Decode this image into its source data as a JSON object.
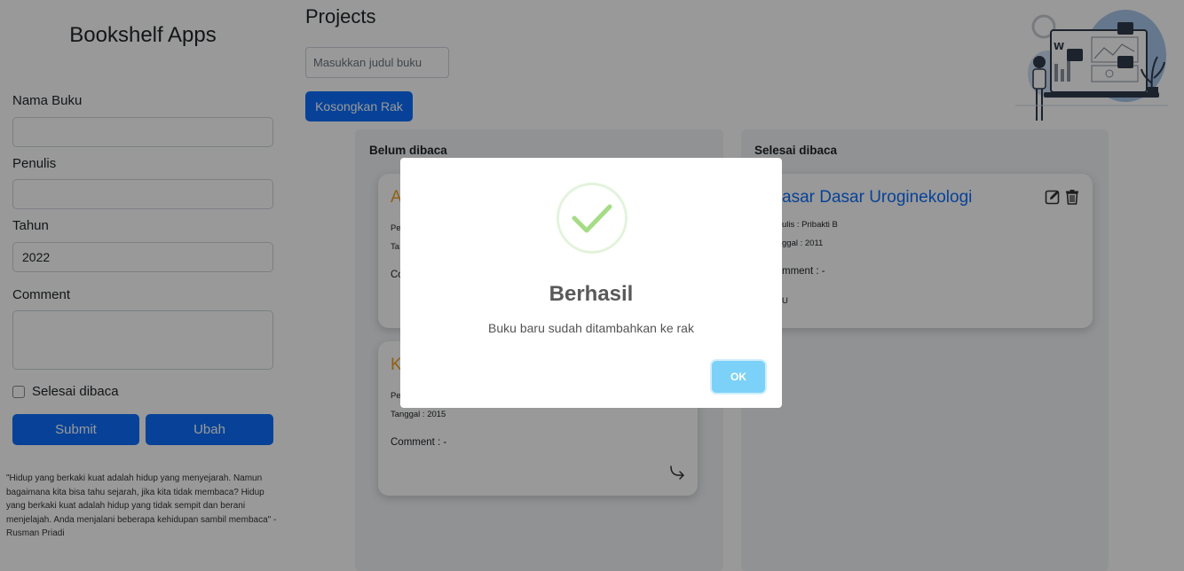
{
  "sidebar": {
    "title": "Bookshelf Apps",
    "name_label": "Nama Buku",
    "name_value": "",
    "author_label": "Penulis",
    "author_value": "",
    "year_label": "Tahun",
    "year_value": "2022",
    "comment_label": "Comment",
    "comment_value": "",
    "finished_label": "Selesai dibaca",
    "finished_checked": false,
    "submit_label": "Submit",
    "update_label": "Ubah",
    "quote": "\"Hidup yang berkaki kuat adalah hidup yang menyejarah. Namun bagaimana kita bisa tahu sejarah, jika kita tidak membaca? Hidup yang berkaki kuat adalah hidup yang tidak sempit dan berani menjelajah. Anda menjalani beberapa kehidupan sambil membaca\" - Rusman Priadi"
  },
  "main": {
    "title": "Projects",
    "search_placeholder": "Masukkan judul buku",
    "clear_label": "Kosongkan Rak"
  },
  "shelves": {
    "unread": {
      "title": "Belum dibaca",
      "books": [
        {
          "title": "A",
          "author_prefix": "Pe",
          "date_prefix": "Ta",
          "comment_prefix": "Co"
        },
        {
          "title": "K",
          "author_prefix": "Pe",
          "date": "Tanggal : 2015",
          "comment": "Comment : -"
        }
      ]
    },
    "read": {
      "title": "Selesai dibaca",
      "books": [
        {
          "title": "asar Dasar Uroginekologi",
          "author": "ulis : Pribakti B",
          "date": "ggal : 2011",
          "comment": "mment : -",
          "extra": "U"
        }
      ]
    }
  },
  "modal": {
    "title": "Berhasil",
    "message": "Buku baru sudah ditambahkan ke rak",
    "ok_label": "OK"
  },
  "colors": {
    "primary": "#0d6efd",
    "title_orange": "#f0a020",
    "success_green": "#a5dc86",
    "ok_button": "#7cd1f9"
  },
  "icons": [
    "edit-icon",
    "trash-icon",
    "move-arrow-icon",
    "checkmark-icon"
  ]
}
